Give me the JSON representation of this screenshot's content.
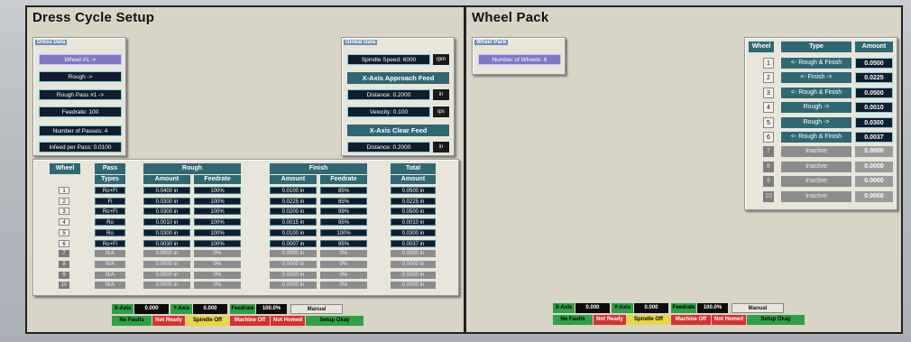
{
  "dress": {
    "title": "Dress Cycle Setup",
    "dress_data_label": "Dress Data",
    "wheel_btn": "Wheel #1 ->",
    "rough_btn": "Rough ->",
    "rough_pass_btn": "Rough Pass #1 ->",
    "feedrate_btn": "Feedrate: 100",
    "passes_btn": "Number of Passes: 4",
    "infeed_btn": "Infeed per Pass: 0.0100",
    "global_label": "Global Data",
    "spindle_speed": "Spindle Speed: 6000",
    "spindle_unit": "rpm",
    "approach_header": "X-Axis Approach Feed",
    "approach_distance": "Distance: 0.2000",
    "approach_distance_unit": "in",
    "approach_velocity": "Velocity: 0.100",
    "approach_velocity_unit": "ips",
    "clear_header": "X-Axis Clear Feed",
    "clear_distance": "Distance: 0.2000",
    "clear_distance_unit": "in",
    "table": {
      "h_wheel": "Wheel",
      "h_pass": "Pass",
      "h_types": "Types",
      "h_rough": "Rough",
      "h_finish": "Finish",
      "h_total": "Total",
      "h_amount": "Amount",
      "h_feedrate": "Feedrate",
      "rows": [
        {
          "n": "1",
          "type": "Ro+Fi",
          "ra": "0.0400 in",
          "rf": "100%",
          "fa": "0.0100 in",
          "ff": "85%",
          "ta": "0.0500 in",
          "active": true
        },
        {
          "n": "2",
          "type": "Fi",
          "ra": "0.0300 in",
          "rf": "100%",
          "fa": "0.0225 in",
          "ff": "85%",
          "ta": "0.0225 in",
          "active": true
        },
        {
          "n": "3",
          "type": "Ro+Fi",
          "ra": "0.0300 in",
          "rf": "100%",
          "fa": "0.0200 in",
          "ff": "99%",
          "ta": "0.0500 in",
          "active": true
        },
        {
          "n": "4",
          "type": "Ro",
          "ra": "0.0010 in",
          "rf": "100%",
          "fa": "0.0015 in",
          "ff": "95%",
          "ta": "0.0010 in",
          "active": true
        },
        {
          "n": "5",
          "type": "Ro",
          "ra": "0.0300 in",
          "rf": "100%",
          "fa": "0.0100 in",
          "ff": "100%",
          "ta": "0.0300 in",
          "active": true
        },
        {
          "n": "6",
          "type": "Ro+Fi",
          "ra": "0.0030 in",
          "rf": "100%",
          "fa": "0.0007 in",
          "ff": "95%",
          "ta": "0.0037 in",
          "active": true
        },
        {
          "n": "7",
          "type": "N/A",
          "ra": "0.0000 in",
          "rf": "0%",
          "fa": "0.0000 in",
          "ff": "0%",
          "ta": "0.0000 in",
          "active": false
        },
        {
          "n": "8",
          "type": "N/A",
          "ra": "0.0000 in",
          "rf": "0%",
          "fa": "0.0000 in",
          "ff": "0%",
          "ta": "0.0000 in",
          "active": false
        },
        {
          "n": "9",
          "type": "N/A",
          "ra": "0.0000 in",
          "rf": "0%",
          "fa": "0.0000 in",
          "ff": "0%",
          "ta": "0.0000 in",
          "active": false
        },
        {
          "n": "10",
          "type": "N/A",
          "ra": "0.0000 in",
          "rf": "0%",
          "fa": "0.0000 in",
          "ff": "0%",
          "ta": "0.0000 in",
          "active": false
        }
      ]
    }
  },
  "status": {
    "x_axis": "X-Axis",
    "x_value": "0.000",
    "y_axis": "Y-Axis",
    "y_value": "0.000",
    "feedrate": "Feedrate",
    "feed_value": "100.0%",
    "manual": "Manual",
    "no_faults": "No Faults",
    "not_ready": "Not Ready",
    "spindle_off": "Spindle Off",
    "machine_off": "Machine Off",
    "not_homed": "Not Homed",
    "setup_okay": "Setup Okay"
  },
  "wheelpack": {
    "title": "Wheel Pack",
    "label": "Wheel Pack",
    "num_wheels": "Number of Wheels: 6",
    "h_wheel": "Wheel",
    "h_type": "Type",
    "h_amount": "Amount",
    "rows": [
      {
        "n": "1",
        "type": "<- Rough & Finish",
        "amt": "0.0500",
        "active": true
      },
      {
        "n": "2",
        "type": "<- Finish ->",
        "amt": "0.0225",
        "active": true
      },
      {
        "n": "3",
        "type": "<- Rough & Finish",
        "amt": "0.0500",
        "active": true
      },
      {
        "n": "4",
        "type": "Rough ->",
        "amt": "0.0010",
        "active": true
      },
      {
        "n": "5",
        "type": "Rough ->",
        "amt": "0.0300",
        "active": true
      },
      {
        "n": "6",
        "type": "<- Rough & Finish",
        "amt": "0.0037",
        "active": true
      },
      {
        "n": "7",
        "type": "Inactive",
        "amt": "0.0000",
        "active": false
      },
      {
        "n": "8",
        "type": "Inactive",
        "amt": "0.0000",
        "active": false
      },
      {
        "n": "9",
        "type": "Inactive",
        "amt": "0.0000",
        "active": false
      },
      {
        "n": "10",
        "type": "Inactive",
        "amt": "0.0000",
        "active": false
      }
    ]
  }
}
